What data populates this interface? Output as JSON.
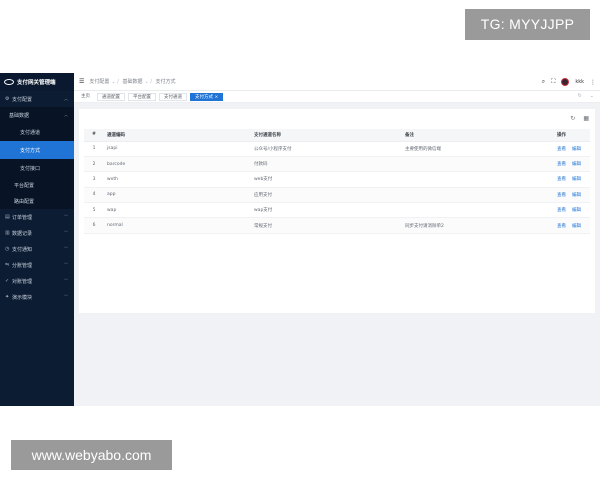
{
  "watermarks": {
    "top": "TG: MYYJJPP",
    "bottom": "www.webyabo.com"
  },
  "sidebar": {
    "title": "支付网关管理端",
    "groups": [
      {
        "label": "支付配置",
        "icon": "gear-icon"
      }
    ],
    "sub_group": "基础数据",
    "sub_items": [
      "支付通道",
      "支付方式",
      "支付接口"
    ],
    "active_sub_item": "支付方式",
    "tail_items": [
      "平台配置",
      "路由配置"
    ],
    "main_items": [
      "订单管理",
      "数据记录",
      "支付通知",
      "分账管理",
      "对账管理",
      "演示模块"
    ]
  },
  "topbar": {
    "breadcrumb": [
      "支付配置",
      "基础数据",
      "支付方式"
    ],
    "username": "kkk"
  },
  "tags": [
    "主页",
    "通道配置",
    "平台配置",
    "支付通道",
    "支付方式"
  ],
  "table": {
    "headers": [
      "#",
      "通道编码",
      "支付通道名称",
      "备注",
      "操作"
    ],
    "rows": [
      {
        "idx": "1",
        "code": "jsapi",
        "name": "公众号/小程序支付",
        "remark": "主要使用的微信端"
      },
      {
        "idx": "2",
        "code": "barcode",
        "name": "付款码",
        "remark": ""
      },
      {
        "idx": "3",
        "code": "wxth",
        "name": "web支付",
        "remark": ""
      },
      {
        "idx": "4",
        "code": "app",
        "name": "应用支付",
        "remark": ""
      },
      {
        "idx": "5",
        "code": "wap",
        "name": "wap支付",
        "remark": ""
      },
      {
        "idx": "6",
        "code": "normal",
        "name": "常规支付",
        "remark": "同步支付请消除单2"
      }
    ],
    "actions": [
      "查看",
      "编辑"
    ]
  },
  "colors": {
    "sidebar": "#0c1c33",
    "accent": "#1f74d6"
  }
}
